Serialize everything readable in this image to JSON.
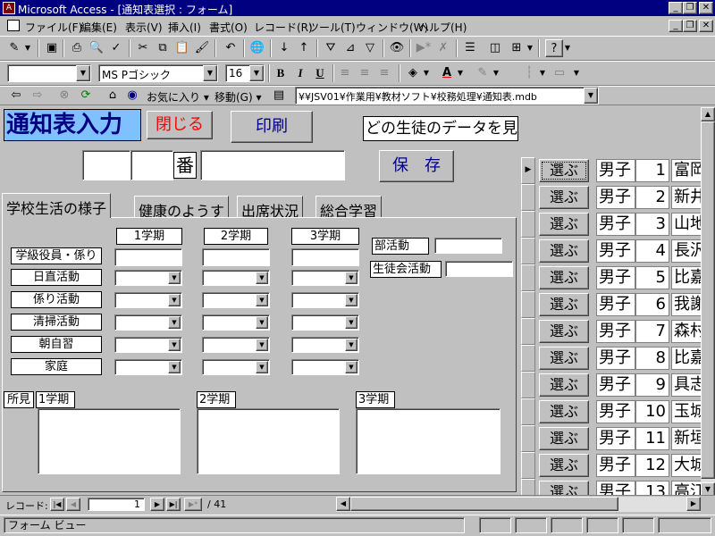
{
  "window": {
    "title": "Microsoft Access - [通知表選択 : フォーム]"
  },
  "menu": [
    "ファイル(F)",
    "編集(E)",
    "表示(V)",
    "挿入(I)",
    "書式(O)",
    "レコード(R)",
    "ツール(T)",
    "ウィンドウ(W)",
    "ヘルプ(H)"
  ],
  "toolbar": {
    "font_name": "MS Pゴシック",
    "font_size": "16",
    "bold": "B",
    "italic": "I",
    "underline": "U"
  },
  "webbar": {
    "favorites": "お気に入り",
    "goto": "移動(G)",
    "address": "¥¥JSV01¥作業用¥教材ソフト¥校務処理¥通知表.mdb"
  },
  "form": {
    "title": "通知表入力",
    "close_label": "閉じる",
    "print_label": "印刷",
    "prompt": "どの生徒のデータを見ますか？「選ぶ」をクリックしてください",
    "ban_label": "番",
    "save_label": "保　存",
    "tabs": [
      "学校生活の様子",
      "健康のようす",
      "出席状況",
      "総合学習"
    ],
    "terms": [
      "1学期",
      "2学期",
      "3学期"
    ],
    "activities": [
      "学級役員・係り",
      "日直活動",
      "係り活動",
      "清掃活動",
      "朝自習",
      "家庭"
    ],
    "club_label": "部活動",
    "council_label": "生徒会活動",
    "remarks_label": "所見",
    "remark_terms": [
      "1学期",
      "2学期",
      "3学期"
    ]
  },
  "students": [
    {
      "select": "選ぶ",
      "gender": "男子",
      "num": "1",
      "name": "富岡"
    },
    {
      "select": "選ぶ",
      "gender": "男子",
      "num": "2",
      "name": "新井"
    },
    {
      "select": "選ぶ",
      "gender": "男子",
      "num": "3",
      "name": "山地"
    },
    {
      "select": "選ぶ",
      "gender": "男子",
      "num": "4",
      "name": "長沢"
    },
    {
      "select": "選ぶ",
      "gender": "男子",
      "num": "5",
      "name": "比嘉"
    },
    {
      "select": "選ぶ",
      "gender": "男子",
      "num": "6",
      "name": "我謝"
    },
    {
      "select": "選ぶ",
      "gender": "男子",
      "num": "7",
      "name": "森村"
    },
    {
      "select": "選ぶ",
      "gender": "男子",
      "num": "8",
      "name": "比嘉"
    },
    {
      "select": "選ぶ",
      "gender": "男子",
      "num": "9",
      "name": "具志"
    },
    {
      "select": "選ぶ",
      "gender": "男子",
      "num": "10",
      "name": "玉城"
    },
    {
      "select": "選ぶ",
      "gender": "男子",
      "num": "11",
      "name": "新垣"
    },
    {
      "select": "選ぶ",
      "gender": "男子",
      "num": "12",
      "name": "大城"
    },
    {
      "select": "選ぶ",
      "gender": "男子",
      "num": "13",
      "name": "高江"
    }
  ],
  "record_nav": {
    "label": "レコード:",
    "current": "1",
    "total": "/ 41"
  },
  "status": {
    "text": "フォーム ビュー"
  }
}
